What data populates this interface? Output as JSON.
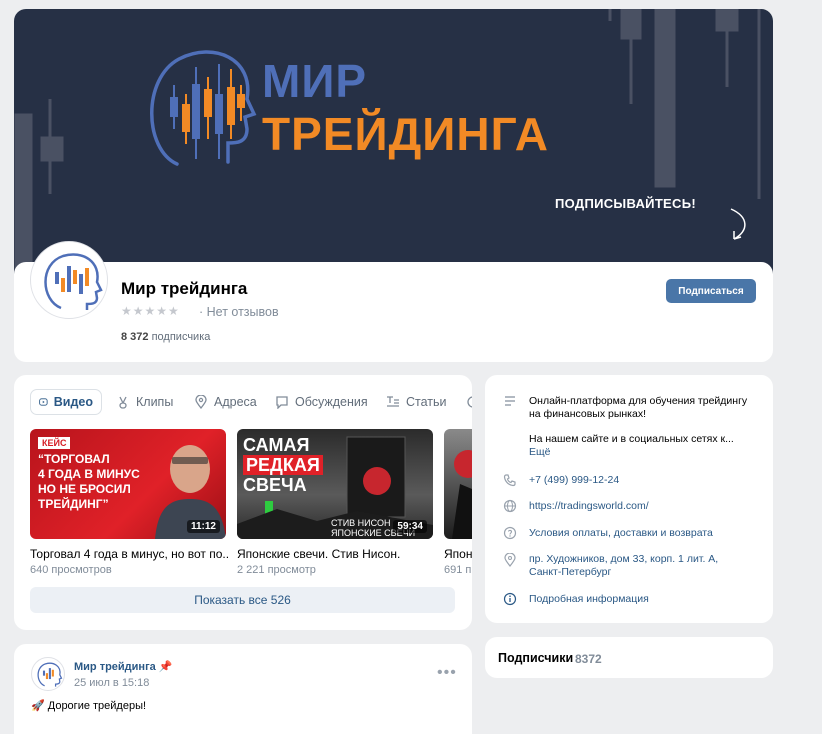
{
  "cover": {
    "title_line1": "МИР",
    "title_line2": "ТРЕЙДИНГА",
    "cta": "ПОДПИСЫВАЙТЕСЬ!",
    "colors": {
      "background": "#263045",
      "blue": "#4f6fb8",
      "orange": "#f28a25"
    }
  },
  "profile": {
    "name": "Мир трейдинга",
    "rating_stars": "★★★★★",
    "reviews": "· Нет отзывов",
    "subscribers_number": "8 372",
    "subscribers_label": "подписчика",
    "subscribe_button": "Подписаться"
  },
  "tabs": [
    {
      "label": "Видео",
      "icon": "video-icon",
      "active": true
    },
    {
      "label": "Клипы",
      "icon": "clips-icon",
      "active": false
    },
    {
      "label": "Адреса",
      "icon": "location-icon",
      "active": false
    },
    {
      "label": "Обсуждения",
      "icon": "discussion-icon",
      "active": false
    },
    {
      "label": "Статьи",
      "icon": "articles-icon",
      "active": false
    }
  ],
  "videos": [
    {
      "title": "Торговал 4 года в минус, но вот по...",
      "views": "640 просмотров",
      "duration": "11:12",
      "badge": "КЕЙС",
      "thumb_lines": [
        "“ТОРГОВАЛ",
        "4 ГОДА В МИНУС",
        "НО НЕ БРОСИЛ",
        "ТРЕЙДИНГ”"
      ]
    },
    {
      "title": "Японские свечи. Стив Нисон.",
      "views": "2 221 просмотр",
      "duration": "59:34",
      "thumb_lines": [
        "САМАЯ",
        "РЕДКАЯ",
        "СВЕЧА"
      ],
      "thumb_bottom": "СТИВ НИСОН",
      "thumb_bottom2": "ЯПОНСКИЕ СВЕЧИ"
    },
    {
      "title": "Япон",
      "views": "691 п"
    }
  ],
  "show_all": "Показать все 526",
  "info": {
    "description_line1": "Онлайн-платформа для обучения трейдингу",
    "description_line2": "на финансовых рынках!",
    "description_line3": "На нашем сайте и в социальных сетях к...",
    "more": "Ещё",
    "phone": "+7 (499) 999-12-24",
    "site": "https://tradingsworld.com/",
    "terms": "Условия оплаты, доставки и возврата",
    "address_line1": "пр. Художников, дом 33, корп. 1 лит. А,",
    "address_line2": "Санкт-Петербург",
    "details": "Подробная информация"
  },
  "subscribers_card": {
    "label": "Подписчики",
    "count": "8372"
  },
  "post": {
    "author": "Мир трейдинга",
    "date": "25 июл в 15:18",
    "text": "🚀 Дорогие трейдеры!",
    "menu": "•••"
  }
}
